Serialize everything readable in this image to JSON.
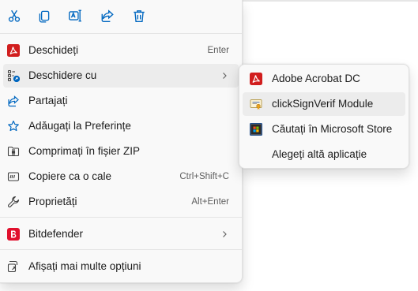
{
  "toolbar": {
    "buttons": [
      {
        "name": "cut",
        "icon": "scissors-icon"
      },
      {
        "name": "copy",
        "icon": "copy-icon"
      },
      {
        "name": "rename",
        "icon": "rename-icon"
      },
      {
        "name": "share",
        "icon": "share-icon"
      },
      {
        "name": "delete",
        "icon": "trash-icon"
      }
    ]
  },
  "menu": {
    "items": [
      {
        "label": "Deschideți",
        "shortcut": "Enter",
        "icon": "pdf-icon"
      },
      {
        "label": "Deschidere cu",
        "shortcut": "",
        "icon": "open-with-icon",
        "has_submenu": true,
        "highlighted": true
      },
      {
        "label": "Partajați",
        "shortcut": "",
        "icon": "share-icon"
      },
      {
        "label": "Adăugați la Preferințe",
        "shortcut": "",
        "icon": "star-icon"
      },
      {
        "label": "Comprimați în fișier ZIP",
        "shortcut": "",
        "icon": "zip-folder-icon"
      },
      {
        "label": "Copiere ca o cale",
        "shortcut": "Ctrl+Shift+C",
        "icon": "copy-path-icon"
      },
      {
        "label": "Proprietăți",
        "shortcut": "Alt+Enter",
        "icon": "wrench-icon"
      },
      {
        "label": "Bitdefender",
        "shortcut": "",
        "icon": "bitdefender-icon",
        "has_submenu": true
      },
      {
        "label": "Afișați mai multe opțiuni",
        "shortcut": "",
        "icon": "more-options-icon"
      }
    ]
  },
  "submenu": {
    "items": [
      {
        "label": "Adobe Acrobat DC",
        "icon": "acrobat-icon"
      },
      {
        "label": "clickSignVerif Module",
        "icon": "certificate-icon",
        "highlighted": true
      },
      {
        "label": "Căutați în Microsoft Store",
        "icon": "microsoft-store-icon"
      },
      {
        "label": "Alegeți altă aplicație",
        "icon": ""
      }
    ]
  },
  "colors": {
    "accent": "#0067c0",
    "pdf_red": "#d11e1e",
    "bitdefender_red": "#e1102d",
    "menu_bg": "#f9f9f9",
    "hover_bg": "#ececec"
  }
}
